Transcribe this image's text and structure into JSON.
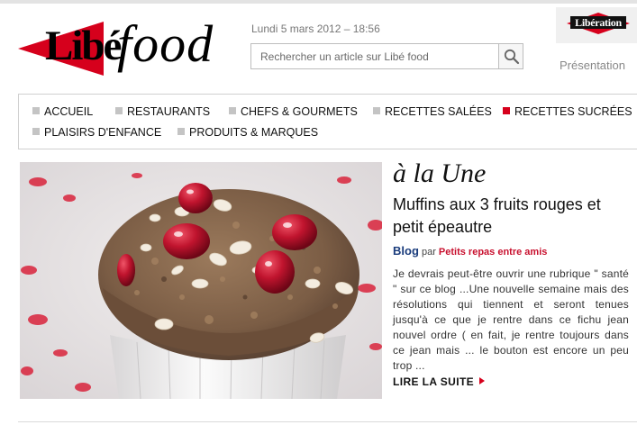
{
  "brand": {
    "logo_libe": "Libé",
    "logo_food": "food"
  },
  "header": {
    "date": "Lundi 5 mars 2012 – 18:56",
    "search_placeholder": "Rechercher un article sur Libé food",
    "partner_logo": "Libération",
    "presentation": "Présentation"
  },
  "nav": {
    "items": [
      {
        "label": "Accueil",
        "active": false
      },
      {
        "label": "Restaurants",
        "active": false
      },
      {
        "label": "Chefs & Gourmets",
        "active": false
      },
      {
        "label": "Recettes salées",
        "active": false
      },
      {
        "label": "Recettes sucrées",
        "active": true
      },
      {
        "label": "Plaisirs d'enfance",
        "active": false
      },
      {
        "label": "Produits & Marques",
        "active": false
      }
    ]
  },
  "feature": {
    "section": "à la Une",
    "title": "Muffins aux 3 fruits rouges et petit épeautre",
    "blog_label": "Blog",
    "by": "par",
    "author": "Petits repas entre amis",
    "excerpt": "Je devrais peut-être ouvrir une rubrique \" santé \" sur ce blog ...Une nouvelle semaine mais des résolutions qui tiennent et seront tenues jusqu'à ce que je rentre dans ce fichu jean nouvel ordre ( en fait, je rentre toujours dans ce jean mais ... le bouton est encore un peu trop ...",
    "read_more": "LIRE LA SUITE"
  },
  "colors": {
    "accent": "#d6001c",
    "blog_blue": "#1a3c7c",
    "nav_square": "#c4c4c4"
  }
}
